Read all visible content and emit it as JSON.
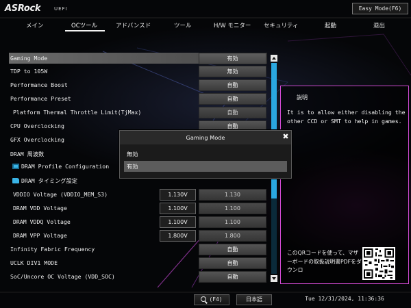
{
  "header": {
    "logo": "ASRock",
    "subtitle": "UEFI",
    "easy_mode_button": "Easy Mode(F6)"
  },
  "nav": {
    "tabs": [
      {
        "label": "メイン"
      },
      {
        "label": "OCツール",
        "active": true
      },
      {
        "label": "アドバンスド"
      },
      {
        "label": "ツール"
      },
      {
        "label": "H/W モニター"
      },
      {
        "label": "セキュリティ"
      },
      {
        "label": "起動"
      },
      {
        "label": "退出"
      }
    ]
  },
  "settings": {
    "rows": [
      {
        "label": "Gaming Mode",
        "value": "有効",
        "selected": true
      },
      {
        "label": "TDP to 105W",
        "value": "無効"
      },
      {
        "label": "Performance Boost",
        "value": "自動"
      },
      {
        "label": "Performance Preset",
        "value": "自動"
      },
      {
        "label": " Platform Thermal Throttle Limit(TjMax)",
        "value": "自動"
      },
      {
        "label": "CPU Overclocking",
        "value": "自動"
      },
      {
        "label": "GFX Overclocking",
        "value": "自動"
      },
      {
        "label": "DRAM 周波数",
        "value": ""
      },
      {
        "label": "DRAM Profile Configuration",
        "icon": "dram-profile-icon"
      },
      {
        "label": "DRAM タイミング設定",
        "icon": "folder-icon"
      },
      {
        "label": "VDDIO Voltage (VDDIO_MEM_S3)",
        "reading": "1.130V",
        "value": "1.130"
      },
      {
        "label": " DRAM VDD Voltage",
        "reading": "1.100V",
        "value": "1.100"
      },
      {
        "label": " DRAM VDDQ Voltage",
        "reading": "1.100V",
        "value": "1.100"
      },
      {
        "label": " DRAM VPP Voltage",
        "reading": "1.800V",
        "value": "1.800"
      },
      {
        "label": "Infinity Fabric Frequency",
        "value": "自動"
      },
      {
        "label": "UCLK DIV1 MODE",
        "value": "自動"
      },
      {
        "label": "SoC/Uncore OC Voltage (VDD_SOC)",
        "value": "自動"
      }
    ]
  },
  "description": {
    "title": "説明",
    "text": "It is to allow either disabling the other CCD or SMT to help in games.",
    "qr_text": "このQRコードを使って、マザーボードの取扱説明書PDFをダウンロ"
  },
  "modal": {
    "title": "Gaming Mode",
    "options": [
      {
        "label": "無効"
      },
      {
        "label": "有効",
        "selected": true
      }
    ]
  },
  "footer": {
    "search_label": "(F4)",
    "language": "日本語",
    "datetime": "Tue 12/31/2024, 11:36:36"
  },
  "colors": {
    "accent_blue": "#2aa7e0",
    "panel_border_magenta": "#d24bd4"
  }
}
